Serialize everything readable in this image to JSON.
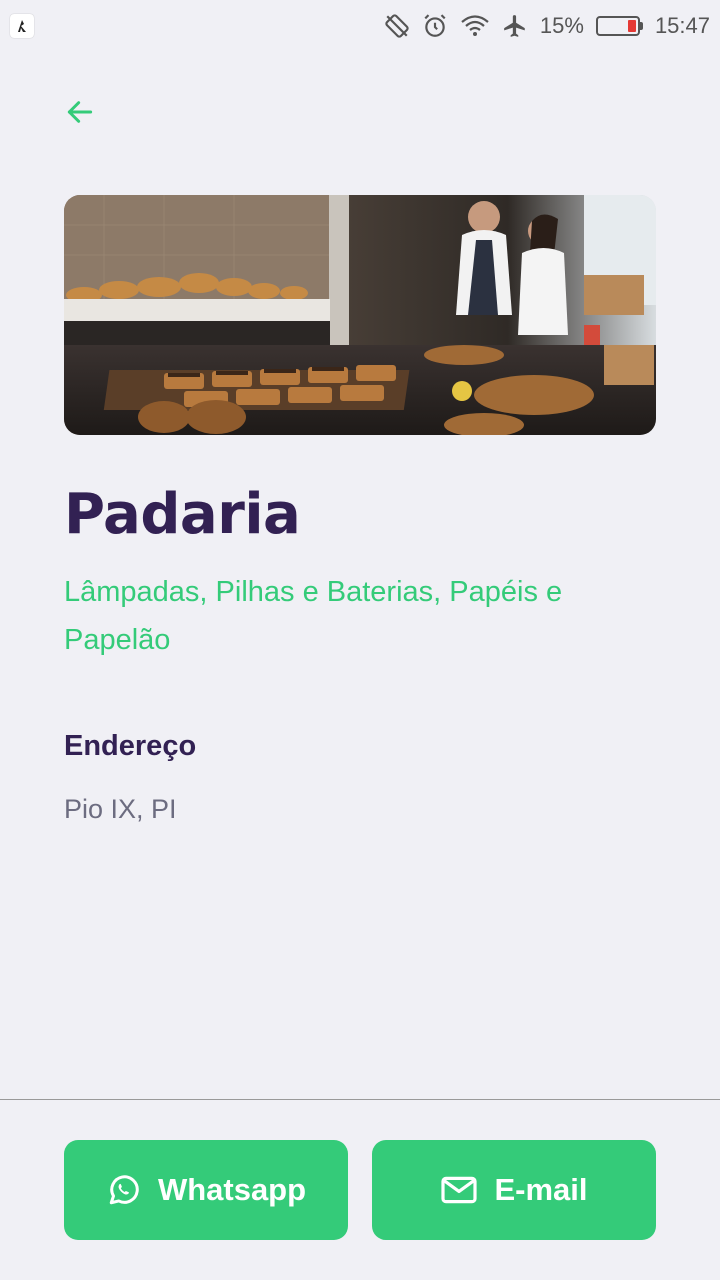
{
  "status_bar": {
    "battery_percent": "15%",
    "time": "15:47",
    "battery_level": 0.15,
    "icons": [
      "screen-rotation-icon",
      "alarm-icon",
      "wifi-icon",
      "airplane-icon"
    ]
  },
  "header": {
    "back_icon": "arrow-left-icon"
  },
  "place": {
    "name": "Padaria",
    "items": "Lâmpadas, Pilhas e Baterias, Papéis e Papelão",
    "address_label": "Endereço",
    "address": "Pio IX, PI"
  },
  "footer": {
    "whatsapp_label": "Whatsapp",
    "email_label": "E-mail"
  },
  "colors": {
    "primary": "#34cb79",
    "title": "#322153",
    "text": "#6c6c80",
    "background": "#f0f0f5"
  }
}
